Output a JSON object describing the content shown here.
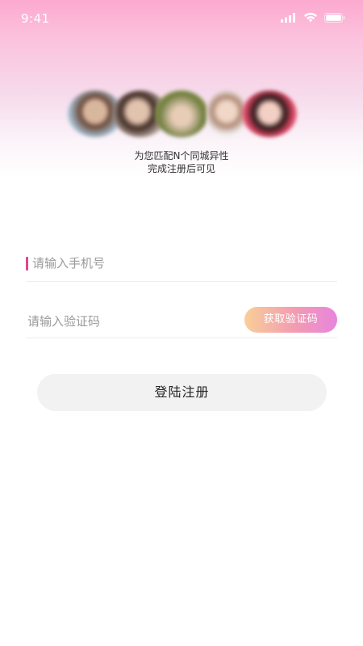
{
  "status_bar": {
    "time": "9:41",
    "icons": [
      "signal-icon",
      "wifi-icon",
      "battery-icon"
    ]
  },
  "avatars": {
    "count": 5
  },
  "tagline": {
    "line1": "为您匹配N个同城异性",
    "line2": "完成注册后可见"
  },
  "phone": {
    "placeholder": "请输入手机号",
    "value": ""
  },
  "code": {
    "placeholder": "请输入验证码",
    "value": "",
    "get_code_label": "获取验证码"
  },
  "login": {
    "label": "登陆注册"
  },
  "colors": {
    "accent": "#e0468d",
    "header_gradient_top": "#fca9cf",
    "code_button_gradient": [
      "#f8cf98",
      "#f39bb2",
      "#e785de"
    ],
    "login_button_bg": "#f2f2f2"
  }
}
